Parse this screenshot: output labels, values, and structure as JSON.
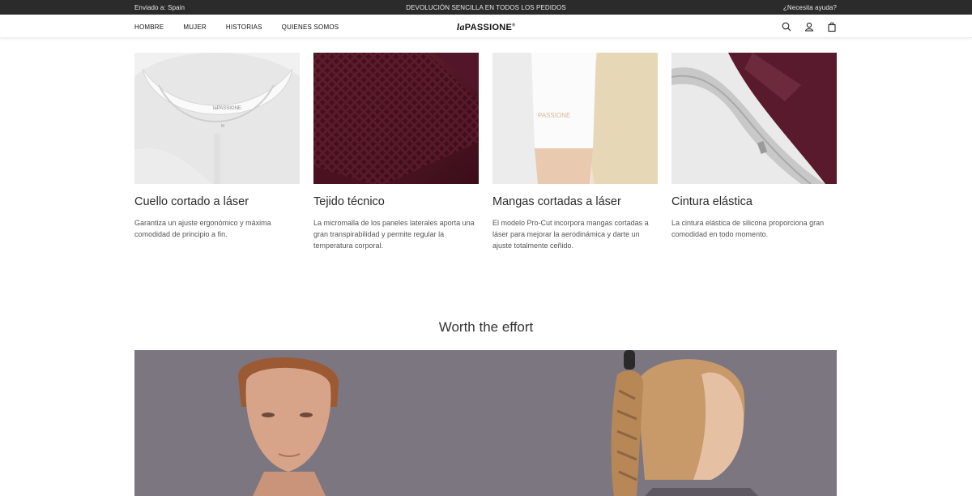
{
  "topbar": {
    "ship_to": "Enviado a: Spain",
    "promo": "DEVOLUCIÓN SENCILLA EN TODOS LOS PEDIDOS",
    "help": "¿Necesita ayuda?"
  },
  "header": {
    "nav": [
      "HOMBRE",
      "MUJER",
      "HISTORIAS",
      "QUIENES SOMOS"
    ],
    "logo_prefix": "la",
    "logo_main": "PASSIONE",
    "icons": [
      "search-icon",
      "account-icon",
      "bag-icon"
    ]
  },
  "features": [
    {
      "title": "Cuello cortado a láser",
      "desc": "Garantiza un ajuste ergonómico y máxima comodidad de principio a fin."
    },
    {
      "title": "Tejido técnico",
      "desc": "La micromalla de los paneles laterales aporta una gran transpirabilidad y permite regular la temperatura corporal."
    },
    {
      "title": "Mangas cortadas a láser",
      "desc": "El modelo Pro-Cut incorpora mangas cortadas a láser para mejorar la aerodinámica y darte un ajuste totalmente ceñido."
    },
    {
      "title": "Cintura elástica",
      "desc": "La cintura elástica de silicona proporciona gran comodidad en todo momento."
    }
  ],
  "section": {
    "title": "Worth the effort"
  },
  "colors": {
    "topbar_bg": "#2b2b2b",
    "hero_bg": "#7b7580",
    "maroon": "#5a1a2a"
  }
}
